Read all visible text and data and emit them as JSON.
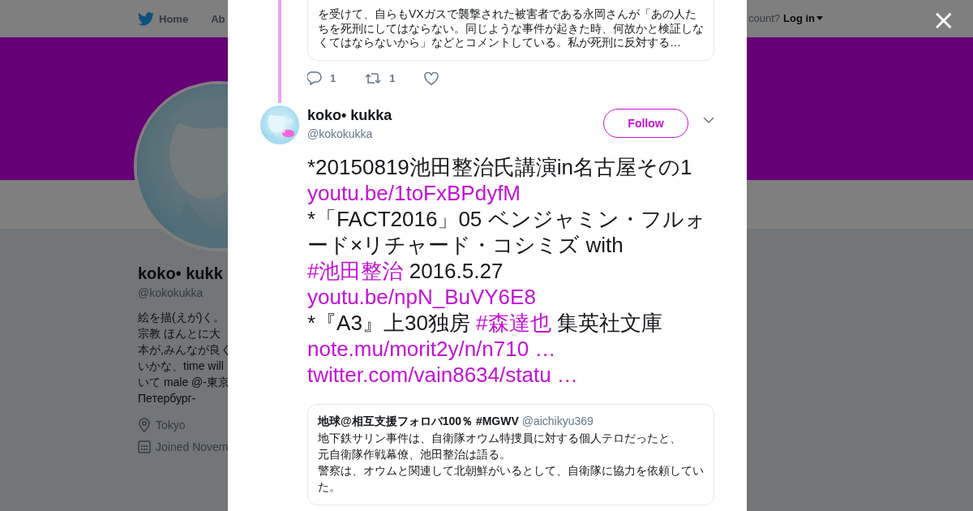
{
  "background_page": {
    "nav": {
      "items": [
        "Home",
        "Ab"
      ],
      "account_prompt": "count?",
      "login": "Log in"
    },
    "profile": {
      "name": "koko• kukk",
      "handle": "@kokokukka",
      "bio_lines": [
        "絵を描(えが)く。",
        "宗教 ほんとに大",
        "本が,みんなが良く",
        "いかな、time will",
        "いて male @-東京",
        "Петербург-"
      ],
      "location": "Tokyo",
      "joined": "Joined Novem"
    }
  },
  "modal": {
    "close": "×",
    "previous_tweet": {
      "quote_lines": [
        "を受けて、自らもVXガスで襲撃された被害者である永岡さんが「あの人た",
        "ちを死刑にしてはならない。同じような事件が起きた時、何故かと検証しな",
        "くてはならないから」などとコメントしている。私が死刑に反対する…"
      ],
      "reply_count": "1",
      "retweet_count": "1"
    },
    "tweet": {
      "name": "koko• kukka",
      "handle": "@kokokukka",
      "follow": "Follow",
      "segments": [
        {
          "kind": "text",
          "text": "*20150819池田整治氏講演in名古屋その1"
        },
        {
          "kind": "break"
        },
        {
          "kind": "link",
          "text": "youtu.be/1toFxBPdyfM"
        },
        {
          "kind": "break"
        },
        {
          "kind": "text",
          "text": "*「FACT2016」05 ベンジャミン・フルォード×リチャード・コシミズ with "
        },
        {
          "kind": "hashtag",
          "text": "#池田整治"
        },
        {
          "kind": "text",
          "text": " 2016.5.27"
        },
        {
          "kind": "break"
        },
        {
          "kind": "link",
          "text": "youtu.be/npN_BuVY6E8"
        },
        {
          "kind": "break"
        },
        {
          "kind": "text",
          "text": "*『A3』上30独房 "
        },
        {
          "kind": "hashtag",
          "text": "#森達也"
        },
        {
          "kind": "text",
          "text": " 集英社文庫"
        },
        {
          "kind": "break"
        },
        {
          "kind": "link",
          "text": "note.mu/morit2y/n/n710 …"
        },
        {
          "kind": "break"
        },
        {
          "kind": "link",
          "text": "twitter.com/vain8634/statu …"
        }
      ],
      "quote": {
        "name": "地球@相互支援フォロバ100％ #MGWV",
        "handle": "@aichikyu369",
        "text_lines": [
          "地下鉄サリン事件は、自衛隊オウム特捜員に対する個人テロだったと、",
          "元自衛隊作戦幕僚、池田整治は語る。",
          "警察は、オウムと関連して北朝鮮がいるとして、自衛隊に協力を依頼していた。"
        ]
      }
    }
  }
}
